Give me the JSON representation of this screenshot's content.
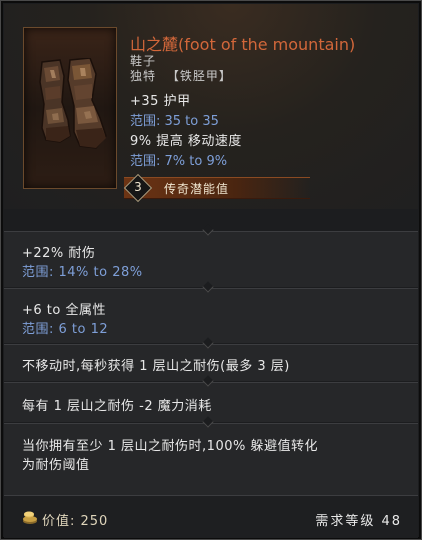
{
  "item": {
    "name": "山之麓(foot of the mountain)",
    "type": "鞋子",
    "rarity": "独特",
    "base": "【铁胫甲】"
  },
  "implicits": [
    {
      "text": "+35 护甲",
      "range": "范围: 35 to 35"
    },
    {
      "text": "9% 提高 移动速度",
      "range": "范围: 7% to 9%"
    }
  ],
  "legendary_potential": {
    "value": "3",
    "label": "传奇潜能值"
  },
  "affixes": [
    {
      "text": "+22% 耐伤",
      "range": "范围: 14% to 28%"
    },
    {
      "text": "+6 to 全属性",
      "range": "范围: 6 to 12"
    },
    {
      "text": "不移动时,每秒获得 1 层山之耐伤(最多 3 层)"
    },
    {
      "text": "每有 1 层山之耐伤 -2 魔力消耗"
    },
    {
      "text": "当你拥有至少 1 层山之耐伤时,100% 躲避值转化",
      "text2": "为耐伤阈值"
    }
  ],
  "footer": {
    "price": "价值: 250",
    "level_requirement": "需求等级 48"
  },
  "icons": [
    "boots-item-icon",
    "coin-icon",
    "potential-diamond-icon"
  ],
  "colors": {
    "unique_name": "#d2673a",
    "range_text": "#7e9fd8",
    "potential_bar": "#6d3414"
  }
}
